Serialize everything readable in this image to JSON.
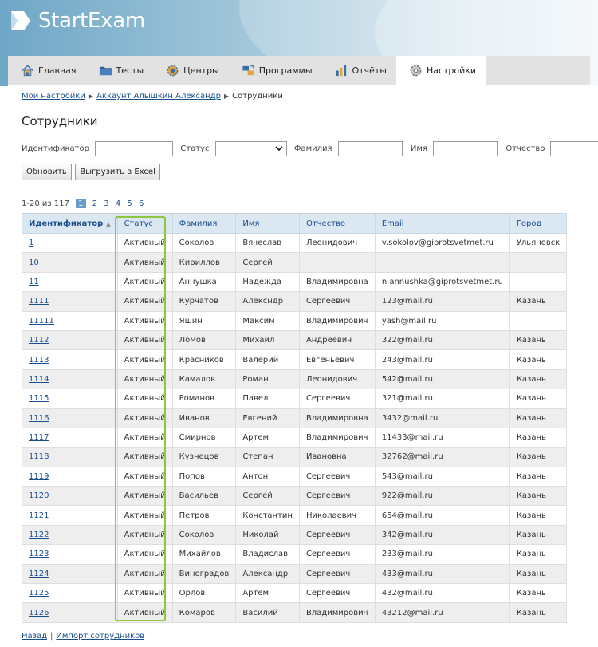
{
  "brand": {
    "name": "StartExam"
  },
  "nav": {
    "tabs": [
      {
        "label": "Главная",
        "icon": "home-icon"
      },
      {
        "label": "Тесты",
        "icon": "folder-icon"
      },
      {
        "label": "Центры",
        "icon": "centers-gear-icon"
      },
      {
        "label": "Программы",
        "icon": "programs-icon"
      },
      {
        "label": "Отчёты",
        "icon": "bar-chart-icon"
      },
      {
        "label": "Настройки",
        "icon": "gear-icon",
        "active": true
      }
    ]
  },
  "breadcrumb": {
    "items": [
      "Мои настройки",
      "Аккаунт Алышкин Александр"
    ],
    "current": "Сотрудники"
  },
  "page": {
    "title": "Сотрудники"
  },
  "filters": {
    "id_label": "Идентификатор",
    "status_label": "Статус",
    "lastname_label": "Фамилия",
    "firstname_label": "Имя",
    "patronymic_label": "Отчество",
    "id_value": "",
    "status_value": "",
    "lastname_value": "",
    "firstname_value": "",
    "patronymic_value": ""
  },
  "buttons": {
    "refresh": "Обновить",
    "export": "Выгрузить в Excel"
  },
  "pager": {
    "summary": "1-20 из 117",
    "current": "1",
    "pages": [
      "2",
      "3",
      "4",
      "5",
      "6"
    ]
  },
  "table": {
    "headers": [
      "Идентификатор",
      "Статус",
      "Фамилия",
      "Имя",
      "Отчество",
      "Email",
      "Город"
    ],
    "rows": [
      [
        "1",
        "Активный",
        "Соколов",
        "Вячеслав",
        "Леонидович",
        "v.sokolov@giprotsvetmet.ru",
        "Ульяновск"
      ],
      [
        "10",
        "Активный",
        "Кириллов",
        "Сергей",
        "",
        "",
        ""
      ],
      [
        "11",
        "Активный",
        "Аннушка",
        "Надежда",
        "Владимировна",
        "n.annushka@giprotsvetmet.ru",
        ""
      ],
      [
        "1111",
        "Активный",
        "Курчатов",
        "Алексндр",
        "Сергеевич",
        "123@mail.ru",
        "Казань"
      ],
      [
        "11111",
        "Активный",
        "Яшин",
        "Максим",
        "Владимирович",
        "yash@mail.ru",
        ""
      ],
      [
        "1112",
        "Активный",
        "Ломов",
        "Михаил",
        "Андреевич",
        "322@mail.ru",
        "Казань"
      ],
      [
        "1113",
        "Активный",
        "Красников",
        "Валерий",
        "Евгеньевич",
        "243@mail.ru",
        "Казань"
      ],
      [
        "1114",
        "Активный",
        "Камалов",
        "Роман",
        "Леонидович",
        "542@mail.ru",
        "Казань"
      ],
      [
        "1115",
        "Активный",
        "Романов",
        "Павел",
        "Сергеевич",
        "321@mail.ru",
        "Казань"
      ],
      [
        "1116",
        "Активный",
        "Иванов",
        "Евгений",
        "Владимировна",
        "3432@mail.ru",
        "Казань"
      ],
      [
        "1117",
        "Активный",
        "Смирнов",
        "Артем",
        "Владимирович",
        "11433@mail.ru",
        "Казань"
      ],
      [
        "1118",
        "Активный",
        "Кузнецов",
        "Степан",
        "Ивановна",
        "32762@mail.ru",
        "Казань"
      ],
      [
        "1119",
        "Активный",
        "Попов",
        "Антон",
        "Сергеевич",
        "543@mail.ru",
        "Казань"
      ],
      [
        "1120",
        "Активный",
        "Васильев",
        "Сергей",
        "Сергеевич",
        "922@mail.ru",
        "Казань"
      ],
      [
        "1121",
        "Активный",
        "Петров",
        "Константин",
        "Николаевич",
        "654@mail.ru",
        "Казань"
      ],
      [
        "1122",
        "Активный",
        "Соколов",
        "Николай",
        "Сергеевич",
        "342@mail.ru",
        "Казань"
      ],
      [
        "1123",
        "Активный",
        "Михайлов",
        "Владислав",
        "Сергеевич",
        "233@mail.ru",
        "Казань"
      ],
      [
        "1124",
        "Активный",
        "Виноградов",
        "Александр",
        "Сергеевич",
        "433@mail.ru",
        "Казань"
      ],
      [
        "1125",
        "Активный",
        "Орлов",
        "Артем",
        "Сергеевич",
        "432@mail.ru",
        "Казань"
      ],
      [
        "1126",
        "Активный",
        "Комаров",
        "Василий",
        "Владимирович",
        "43212@mail.ru",
        "Казань"
      ]
    ]
  },
  "footer": {
    "back": "Назад",
    "import": "Импорт сотрудников"
  },
  "colors": {
    "accent": "#1a4f8f",
    "highlight": "#8dc63f",
    "header_bg": "#dbe7f1",
    "active_page": "#6b9cc8"
  }
}
